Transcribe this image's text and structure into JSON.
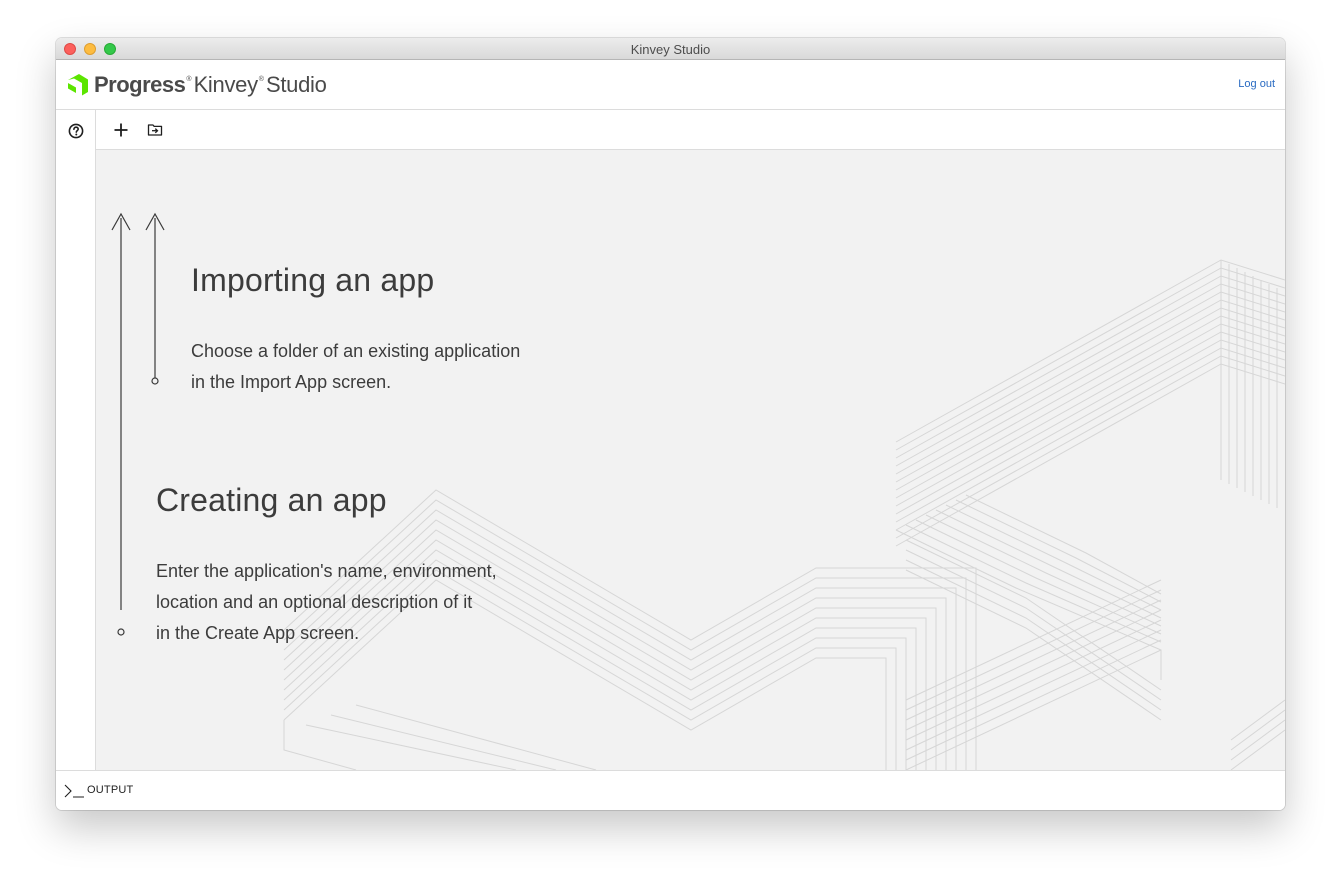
{
  "window": {
    "title": "Kinvey Studio"
  },
  "header": {
    "logo_progress": "Progress",
    "logo_kinvey": "Kinvey",
    "logo_studio": "Studio",
    "logout_label": "Log out"
  },
  "toolbar": {
    "add_icon": "plus-icon",
    "import_icon": "folder-import-icon"
  },
  "sidebar": {
    "help_icon": "help-circle-icon"
  },
  "content": {
    "import": {
      "title": "Importing an app",
      "line1": "Choose a folder of an existing application",
      "line2": "in the Import App screen."
    },
    "create": {
      "title": "Creating an app",
      "line1": "Enter the application's name, environment,",
      "line2": "location and an optional description of it",
      "line3": "in the Create App screen."
    }
  },
  "output": {
    "label": "OUTPUT",
    "icon": "terminal-prompt-icon"
  },
  "colors": {
    "brand_green": "#5ce500",
    "link_blue": "#2a6bc2",
    "content_bg": "#f2f2f2",
    "text": "#3c3c3c"
  }
}
